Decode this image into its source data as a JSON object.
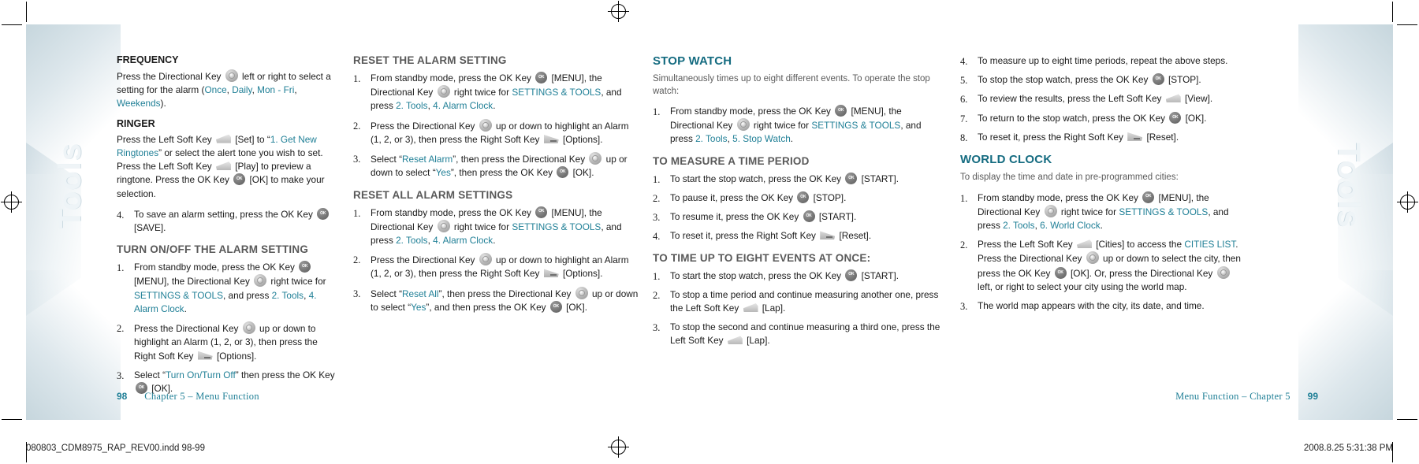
{
  "document": {
    "thumb_tab_label": "Tools",
    "left_footer": {
      "page_number": "98",
      "chapter": "Chapter 5 – Menu Function"
    },
    "right_footer": {
      "page_number": "99",
      "chapter": "Menu Function – Chapter 5"
    },
    "slug_left": "080803_CDM8975_RAP_REV00.indd   98-99",
    "slug_right": "2008.8.25   5:31:38 PM"
  },
  "colors": {
    "teal": "#1f7f96",
    "heading_teal": "#146b80",
    "section_gray": "#595959",
    "body": "#1a1a1a"
  },
  "columns": {
    "col1": {
      "blocks": [
        {
          "type": "subheading",
          "title": "FREQUENCY",
          "paragraph_pre": "Press the Directional Key ",
          "paragraph_mid": " left or right to select a setting for the alarm (",
          "links": [
            "Once",
            "Daily",
            "Mon - Fri",
            "Weekends"
          ],
          "paragraph_post": ")."
        },
        {
          "type": "subheading",
          "title": "RINGER",
          "text_1": "Press the Left Soft Key ",
          "text_2": " [Set] to “",
          "link_1": "1. Get New Ringtones",
          "text_3": "” or select the alert tone you wish to set. Press the Left Soft Key ",
          "text_4": " [Play] to preview a ringtone.  Press the OK Key ",
          "text_5": " [OK] to make your selection."
        }
      ],
      "step4": {
        "num": "4.",
        "text_1": "To save an alarm setting, press the OK Key ",
        "text_2": " [SAVE]."
      },
      "section2_title": "TURN ON/OFF THE ALARM SETTING",
      "section2_steps": [
        {
          "num": "1.",
          "t1": "From standby mode, press the OK Key ",
          "t2": " [MENU], the Directional Key ",
          "t3": " right twice for ",
          "l1": "SETTINGS & TOOLS",
          "t4": ", and press ",
          "l2": "2. Tools",
          "t5": ", ",
          "l3": "4. Alarm Clock",
          "t6": "."
        },
        {
          "num": "2.",
          "t1": "Press the Directional Key ",
          "t2": " up or down to highlight an Alarm (1, 2, or 3), then press the Right Soft Key ",
          "t3": " [Options]."
        },
        {
          "num": "3.",
          "t1": "Select “",
          "l1": "Turn On/Turn Off",
          "t2": "” then press the OK Key ",
          "t3": " [OK]."
        }
      ]
    },
    "col2": {
      "section1_title": "RESET THE ALARM SETTING",
      "section1_steps": [
        {
          "num": "1.",
          "t1": "From standby mode, press the OK Key ",
          "t2": " [MENU], the Directional Key ",
          "t3": " right twice for ",
          "l1": "SETTINGS & TOOLS",
          "t4": ", and press ",
          "l2": "2. Tools",
          "t5": ", ",
          "l3": "4. Alarm Clock",
          "t6": "."
        },
        {
          "num": "2.",
          "t1": "Press the Directional Key ",
          "t2": " up or down to highlight an Alarm (1, 2, or 3), then press the Right Soft Key ",
          "t3": " [Options]."
        },
        {
          "num": "3.",
          "t1": "Select “",
          "l1": "Reset Alarm",
          "t2": "”, then press the Directional Key ",
          "t3": " up or down to select “",
          "l2": "Yes",
          "t4": "”, then press the OK Key ",
          "t5": " [OK]."
        }
      ],
      "section2_title": "RESET ALL ALARM SETTINGS",
      "section2_steps": [
        {
          "num": "1.",
          "t1": "From standby mode, press the OK Key ",
          "t2": " [MENU], the Directional Key ",
          "t3": " right twice for ",
          "l1": "SETTINGS & TOOLS",
          "t4": ", and press ",
          "l2": "2. Tools",
          "t5": ", ",
          "l3": "4. Alarm Clock",
          "t6": "."
        },
        {
          "num": "2.",
          "t1": "Press the Directional Key ",
          "t2": " up or down to highlight an Alarm (1, 2, or 3), then press the Right Soft Key ",
          "t3": " [Options]."
        },
        {
          "num": "3.",
          "t1": "Select “",
          "l1": "Reset All",
          "t2": "”, then press the Directional Key ",
          "t3": " up or down to select “",
          "l2": "Yes",
          "t4": "”, and then press the OK Key ",
          "t5": " [OK]."
        }
      ]
    },
    "col3": {
      "title": "STOP WATCH",
      "subtitle": "Simultaneously times up to eight different events. To operate the stop watch:",
      "intro_step": {
        "num": "1.",
        "t1": "From standby mode, press the OK Key ",
        "t2": " [MENU], the Directional Key ",
        "t3": " right twice for ",
        "l1": "SETTINGS & TOOLS",
        "t4": ", and press ",
        "l2": "2. Tools",
        "t5": ", ",
        "l3": "5. Stop Watch",
        "t6": "."
      },
      "section1_title": "TO MEASURE A TIME PERIOD",
      "section1_steps": [
        {
          "num": "1.",
          "t1": "To start the stop watch, press the OK Key ",
          "t2": " [START]."
        },
        {
          "num": "2.",
          "t1": "To pause it, press the OK Key ",
          "t2": " [STOP]."
        },
        {
          "num": "3.",
          "t1": "To resume it, press the OK Key ",
          "t2": " [START]."
        },
        {
          "num": "4.",
          "t1": "To reset it, press the Right Soft Key ",
          "t2": " [Reset]."
        }
      ],
      "section2_title": "TO TIME UP TO EIGHT EVENTS AT ONCE:",
      "section2_steps": [
        {
          "num": "1.",
          "t1": "To start the stop watch, press the OK Key ",
          "t2": " [START]."
        },
        {
          "num": "2.",
          "t1": "To stop a time period and continue measuring another one, press the Left Soft Key ",
          "t2": " [Lap]."
        },
        {
          "num": "3.",
          "t1": "To stop the second and continue measuring a third one, press the Left Soft Key ",
          "t2": " [Lap]."
        }
      ]
    },
    "col4": {
      "continued_steps": [
        {
          "num": "4.",
          "t1": "To measure up to eight time periods, repeat the above steps.",
          "t2": ""
        },
        {
          "num": "5.",
          "t1": "To stop the stop watch, press the OK Key ",
          "t2": " [STOP]."
        },
        {
          "num": "6.",
          "t1": "To review the results, press the Left Soft Key ",
          "t2": " [View]."
        },
        {
          "num": "7.",
          "t1": "To return to the stop watch, press the OK Key ",
          "t2": " [OK]."
        },
        {
          "num": "8.",
          "t1": "To reset it, press the Right Soft Key ",
          "t2": " [Reset]."
        }
      ],
      "title": "WORLD CLOCK",
      "subtitle": "To display the time and date in pre-programmed cities:",
      "steps": [
        {
          "num": "1.",
          "t1": "From standby mode, press the OK Key ",
          "t2": " [MENU], the Directional Key ",
          "t3": " right twice for ",
          "l1": "SETTINGS & TOOLS",
          "t4": ", and press ",
          "l2": "2. Tools",
          "t5": ", ",
          "l3": "6. World Clock",
          "t6": "."
        },
        {
          "num": "2.",
          "t1": "Press the Left Soft Key ",
          "t2": " [Cities] to access the ",
          "l1": "CITIES LIST",
          "t3": ". Press the Directional Key ",
          "t4": " up or down to select the city, then press the OK Key ",
          "t5": " [OK]. Or, press the Directional Key ",
          "t6": " left, or right to select your city using the world map."
        },
        {
          "num": "3.",
          "t1": "The world map appears with the city, its date, and time."
        }
      ]
    }
  },
  "icons": {
    "ok_key": "ok-key-icon",
    "directional_key": "directional-key-icon",
    "left_soft_key": "left-soft-key-icon",
    "right_soft_key": "right-soft-key-icon"
  }
}
